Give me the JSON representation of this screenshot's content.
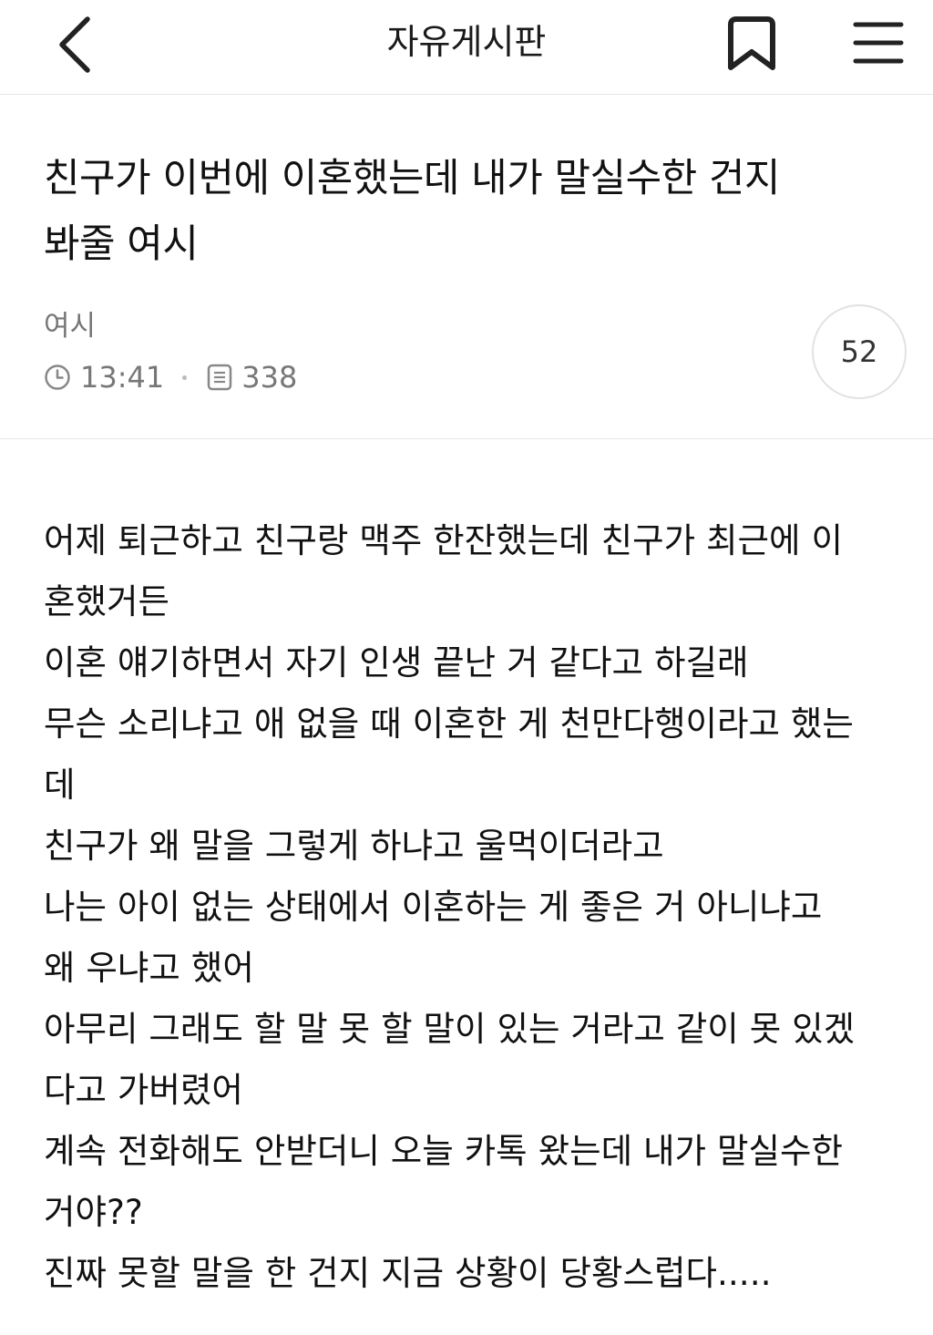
{
  "topbar": {
    "board_name": "자유게시판",
    "back_icon": "chevron-left-icon",
    "bookmark_icon": "bookmark-icon",
    "menu_icon": "hamburger-menu-icon"
  },
  "post": {
    "title_line1": "친구가 이번에 이혼했는데 내가 말실수한 건지",
    "title_line2": "봐줄 여시",
    "author": "여시",
    "time": "13:41",
    "views": "338",
    "comment_count": "52",
    "body_lines": [
      "어제 퇴근하고 친구랑 맥주 한잔했는데 친구가 최근에 이",
      "혼했거든",
      "이혼 얘기하면서 자기 인생 끝난 거 같다고 하길래",
      "무슨 소리냐고 애 없을 때 이혼한 게 천만다행이라고 했는",
      "데",
      "친구가 왜 말을 그렇게 하냐고 울먹이더라고",
      "나는 아이 없는 상태에서 이혼하는 게 좋은 거 아니냐고",
      "왜 우냐고 했어",
      "아무리 그래도 할 말 못 할 말이 있는 거라고 같이 못 있겠",
      "다고 가버렸어",
      "계속 전화해도 안받더니 오늘 카톡 왔는데 내가 말실수한",
      "거야??",
      "진짜 못할 말을 한 건지 지금 상황이 당황스럽다....."
    ]
  },
  "colors": {
    "text_primary": "#111111",
    "text_secondary": "#777777",
    "divider": "#e6e6e6",
    "badge_border": "#e2e2e2"
  }
}
